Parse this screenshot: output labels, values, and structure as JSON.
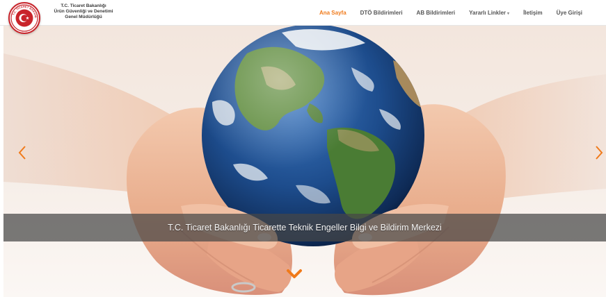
{
  "header": {
    "logo": {
      "icon": "tc-ticaret-bakanligi-seal-icon",
      "text": "T.C. TİCARET BAKANLIĞI"
    },
    "brand_lines": [
      "T.C. Ticaret  Bakanlığı",
      "Ürün Güvenliği ve Denetimi",
      "Genel Müdürlüğü"
    ]
  },
  "nav": {
    "items": [
      {
        "label": "Ana Sayfa",
        "active": true
      },
      {
        "label": "DTÖ Bildirimleri",
        "active": false
      },
      {
        "label": "AB Bildirimleri",
        "active": false
      },
      {
        "label": "Yararlı Linkler",
        "active": false,
        "has_dropdown": true
      },
      {
        "label": "İletişim",
        "active": false
      },
      {
        "label": "Üye Girişi",
        "active": false
      }
    ]
  },
  "hero": {
    "caption": "T.C. Ticaret Bakanlığı Ticarette Teknik Engeller Bilgi ve Bildirim Merkezi",
    "prev_icon": "chevron-left-icon",
    "next_icon": "chevron-right-icon",
    "scroll_icon": "chevron-down-icon",
    "image": "hands-holding-globe-image"
  },
  "colors": {
    "accent": "#f07a1a",
    "nav_text": "#555555",
    "seal_red": "#c9242b",
    "caption_bg": "rgba(70,70,70,0.72)"
  }
}
